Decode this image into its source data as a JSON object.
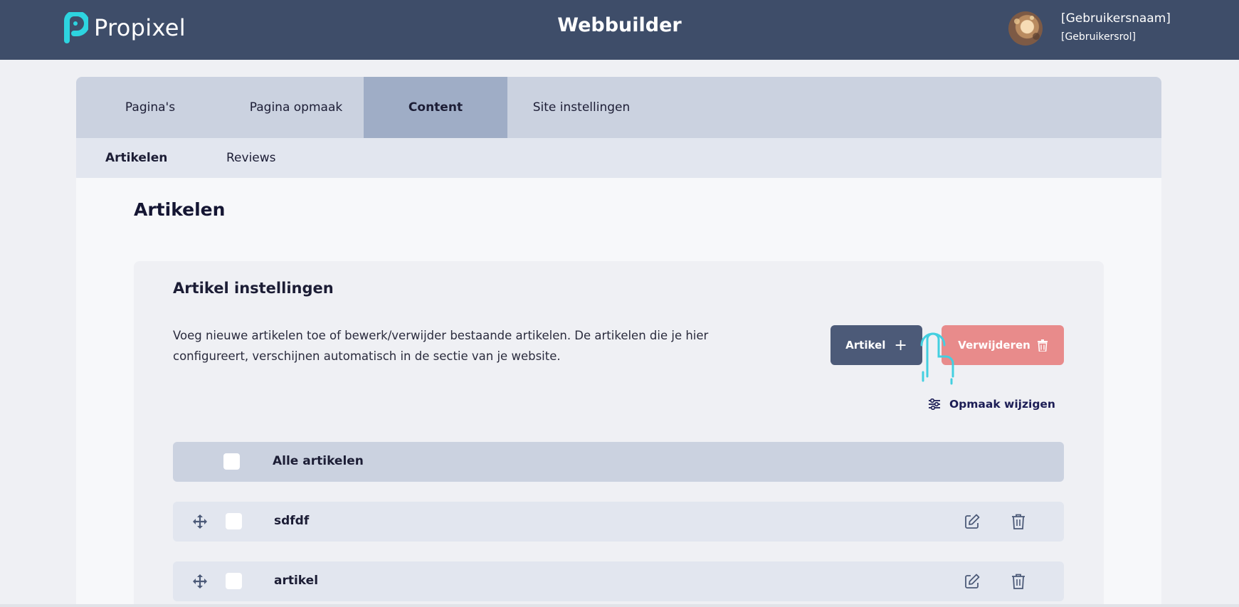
{
  "header": {
    "brand": "Propixel",
    "app_title": "Webbuilder",
    "user_name": "[Gebruikersnaam]",
    "user_role": "[Gebruikersrol]"
  },
  "tabs": [
    {
      "label": "Pagina's",
      "active": false
    },
    {
      "label": "Pagina opmaak",
      "active": false
    },
    {
      "label": "Content",
      "active": true
    },
    {
      "label": "Site instellingen",
      "active": false
    }
  ],
  "subtabs": [
    {
      "label": "Artikelen",
      "active": true
    },
    {
      "label": "Reviews",
      "active": false
    }
  ],
  "page_title": "Artikelen",
  "card": {
    "title": "Artikel instellingen",
    "description": "Voeg nieuwe artikelen toe of bewerk/verwijder bestaande artikelen. De artikelen die je hier configureert, verschijnen automatisch in de sectie van je website.",
    "add_button": "Artikel",
    "add_icon": "plus-icon",
    "delete_button": "Verwijderen",
    "delete_icon": "trash-icon",
    "layout_link": "Opmaak wijzigen",
    "layout_icon": "sliders-icon"
  },
  "list": {
    "header_label": "Alle artikelen",
    "items": [
      {
        "title": "sdfdf"
      },
      {
        "title": "artikel"
      }
    ]
  },
  "colors": {
    "header_bg": "#3e4d69",
    "brand_accent": "#2dd4e0",
    "add_button": "#4c5a78",
    "delete_button": "#e88b8b",
    "active_tab": "#9fadc6"
  }
}
